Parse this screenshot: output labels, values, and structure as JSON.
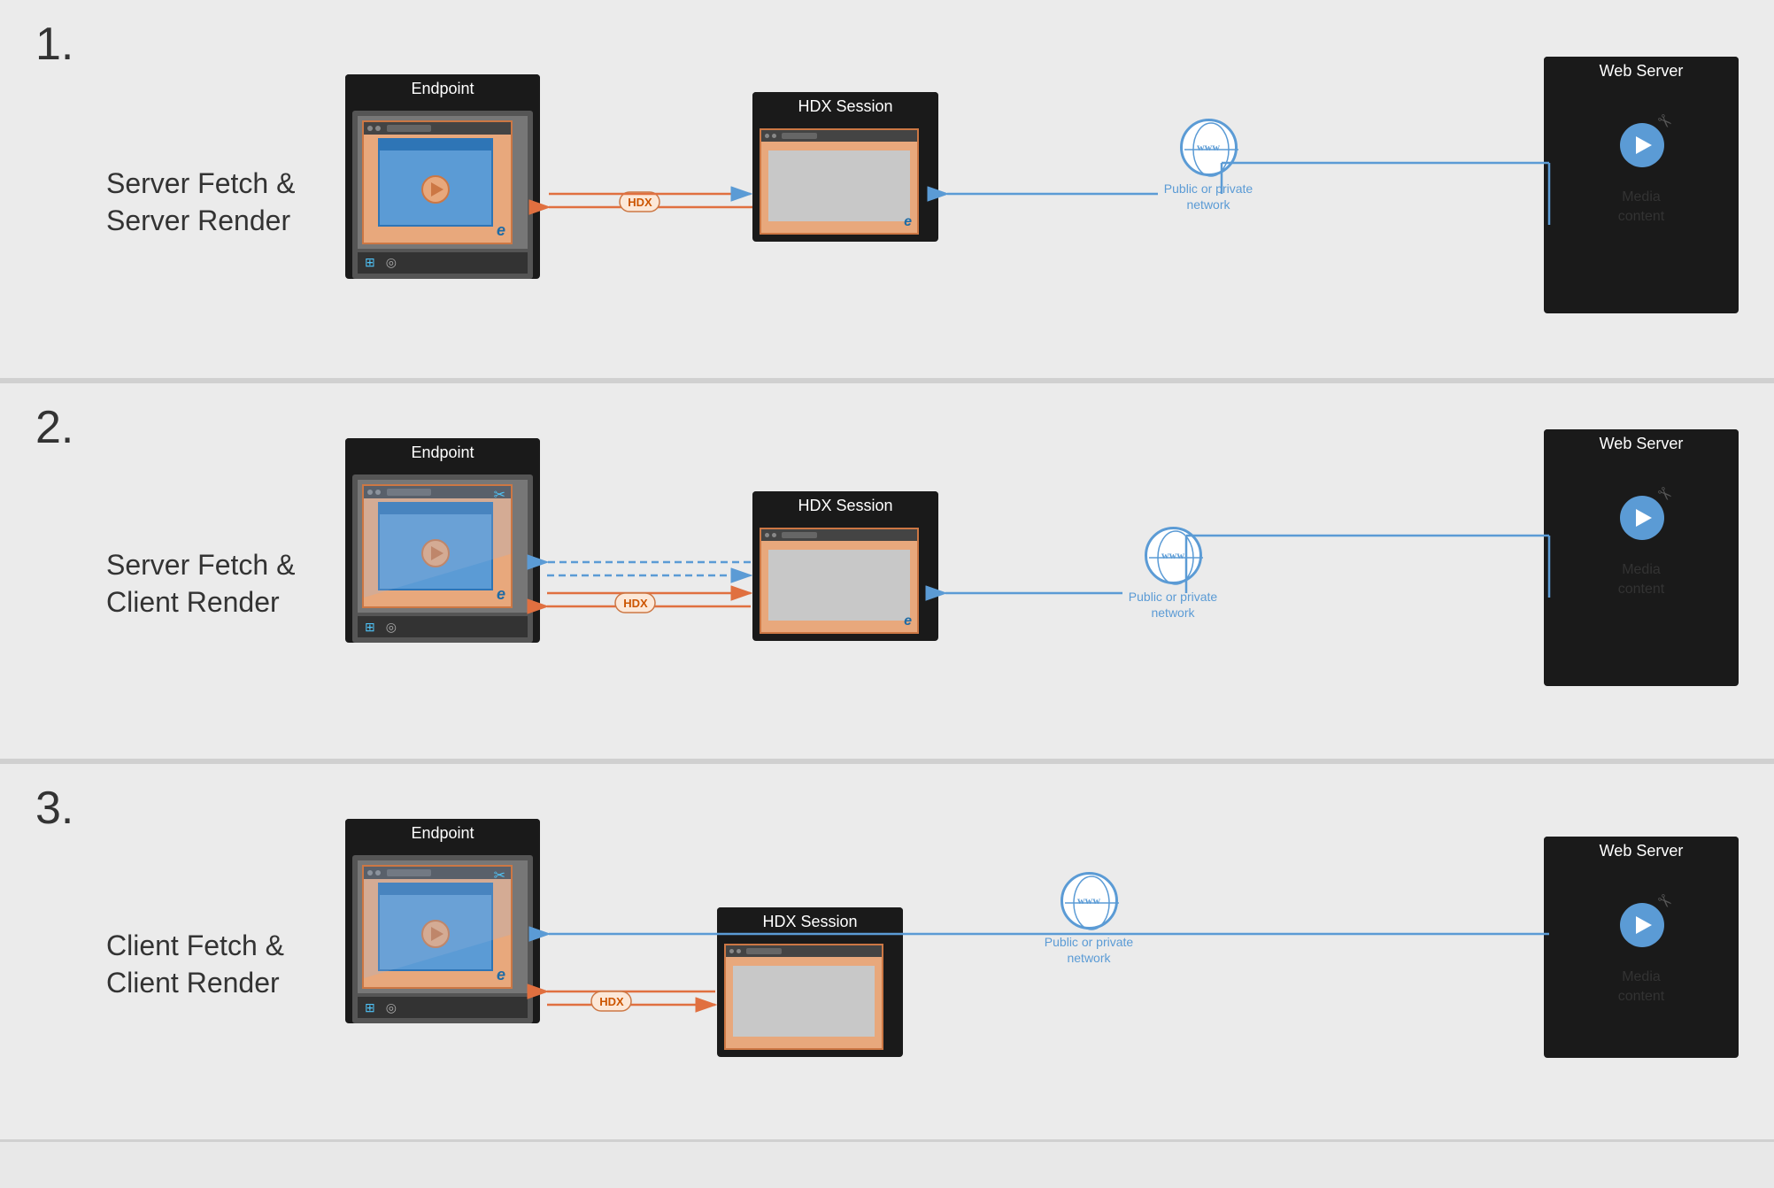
{
  "scenarios": [
    {
      "number": "1.",
      "title_line1": "Server Fetch &",
      "title_line2": "Server Render",
      "endpoint_label": "Endpoint",
      "hdx_label": "HDX Session",
      "webserver_label": "Web Server",
      "media_label": "Media\ncontent",
      "network_label": "Public or private\nnetwork",
      "hdx_pill": "HDX",
      "type": "server_fetch_server_render"
    },
    {
      "number": "2.",
      "title_line1": "Server Fetch &",
      "title_line2": "Client Render",
      "endpoint_label": "Endpoint",
      "hdx_label": "HDX Session",
      "webserver_label": "Web Server",
      "media_label": "Media\ncontent",
      "network_label": "Public or private\nnetwork",
      "hdx_pill": "HDX",
      "type": "server_fetch_client_render"
    },
    {
      "number": "3.",
      "title_line1": "Client Fetch &",
      "title_line2": "Client Render",
      "endpoint_label": "Endpoint",
      "hdx_label": "HDX Session",
      "webserver_label": "Web Server",
      "media_label": "Media\ncontent",
      "network_label": "Public or private\nnetwork",
      "hdx_pill": "HDX",
      "type": "client_fetch_client_render"
    }
  ],
  "colors": {
    "orange": "#e07040",
    "blue": "#5b9bd5",
    "dark": "#1a1a1a",
    "bg": "#ebebeb"
  }
}
